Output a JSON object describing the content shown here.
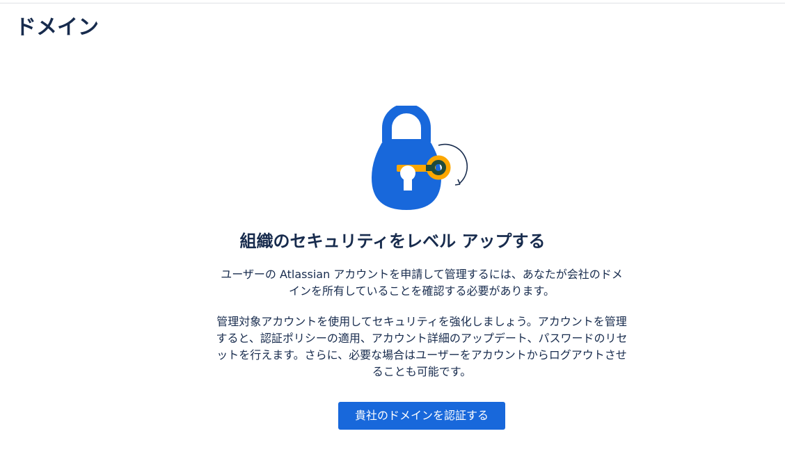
{
  "page": {
    "title": "ドメイン"
  },
  "empty_state": {
    "heading": "組織のセキュリティをレベル アップする",
    "paragraph_1": "ユーザーの Atlassian アカウントを申請して管理するには、あなたが会社のドメインを所有していることを確認する必要があります。",
    "paragraph_2": "管理対象アカウントを使用してセキュリティを強化しましょう。アカウントを管理すると、認証ポリシーの適用、アカウント詳細のアップデート、パスワードのリセットを行えます。さらに、必要な場合はユーザーをアカウントからログアウトさせることも可能です。",
    "button_label": "貴社のドメインを認証する",
    "illustration": "padlock-with-key-icon"
  },
  "colors": {
    "primary": "#1868DB",
    "lock_body": "#1868DB",
    "key_yellow": "#FCA700",
    "key_dark": "#1F4B3C",
    "text": "#172B4D"
  }
}
